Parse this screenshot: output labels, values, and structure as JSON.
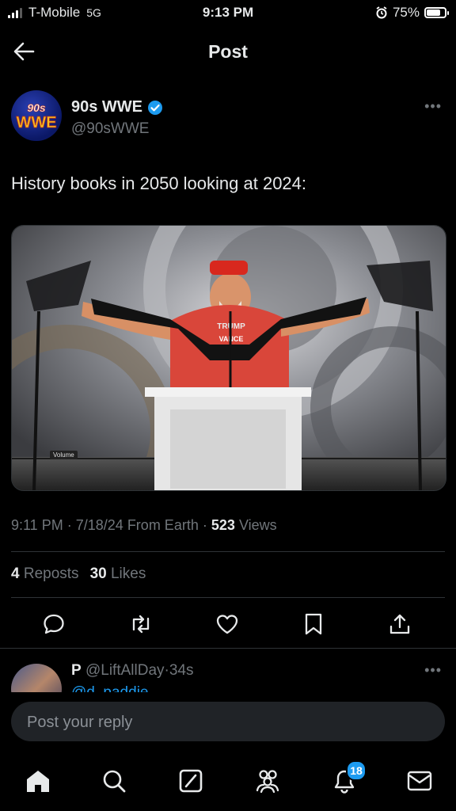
{
  "status_bar": {
    "carrier": "T-Mobile",
    "network": "5G",
    "time": "9:13 PM",
    "battery": "75%",
    "battery_level": 0.75
  },
  "header": {
    "title": "Post"
  },
  "author": {
    "logo_top": "90s",
    "logo_bottom": "WWE",
    "name": "90s WWE",
    "handle": "@90sWWE",
    "verified": true,
    "verified_color": "#1d9bf0"
  },
  "tweet": {
    "text": "History books in 2050 looking at 2024:",
    "video_label": "Volume"
  },
  "meta": {
    "time": "9:11 PM",
    "date": "7/18/24",
    "source": "From Earth",
    "views": "523",
    "views_label": "Views",
    "sep": "·"
  },
  "stats": {
    "reposts": "4",
    "reposts_label": "Reposts",
    "likes": "30",
    "likes_label": "Likes"
  },
  "reply": {
    "name": "P",
    "handle": "@LiftAllDay",
    "time": "34s",
    "sep": "·",
    "mention": "@d_paddie"
  },
  "reply_input": {
    "placeholder": "Post your reply"
  },
  "tabs": {
    "notifications_badge": "18"
  },
  "colors": {
    "accent": "#1d9bf0",
    "background": "#000000",
    "muted": "#71767b"
  }
}
